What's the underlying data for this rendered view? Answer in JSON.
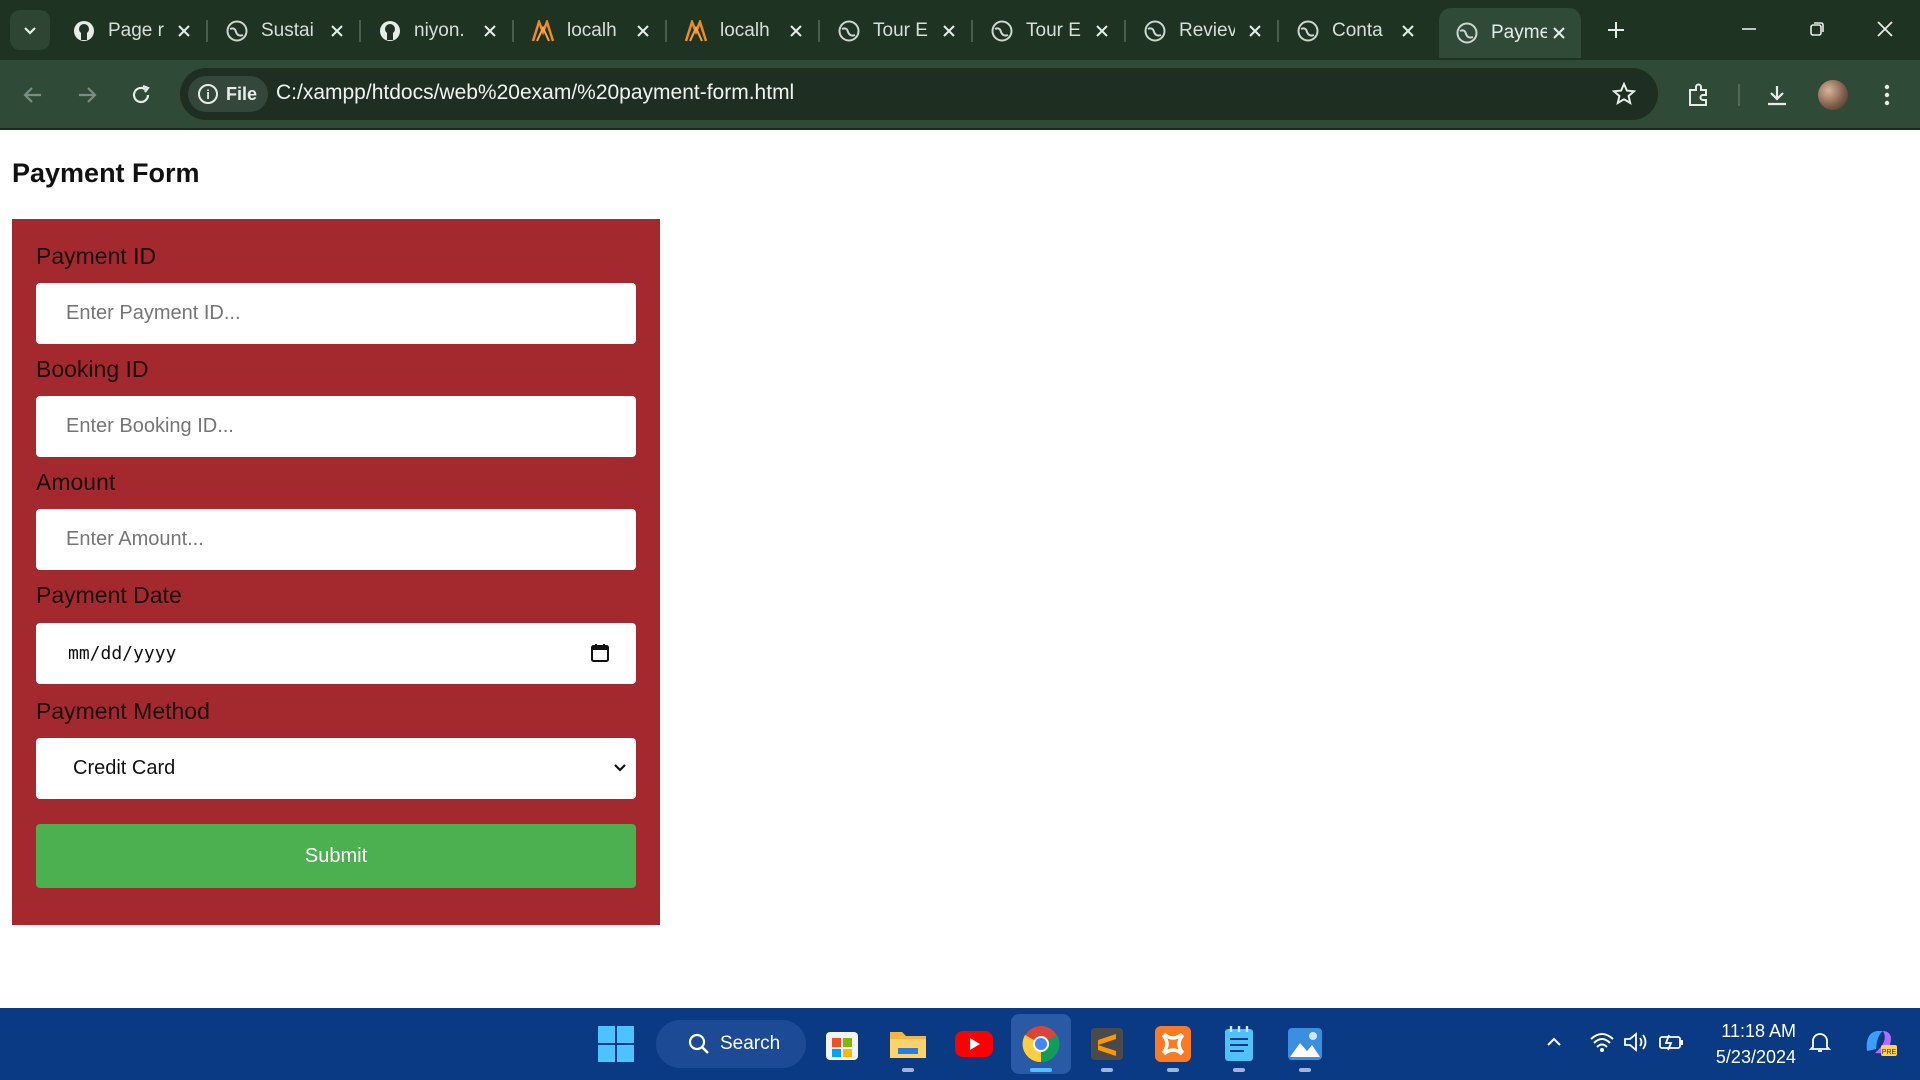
{
  "browser": {
    "tabs": [
      {
        "title": "Page r",
        "icon": "github-icon"
      },
      {
        "title": "Sustai",
        "icon": "globe-icon"
      },
      {
        "title": "niyon.",
        "icon": "github-icon"
      },
      {
        "title": "localh",
        "icon": "xampp-icon"
      },
      {
        "title": "localh",
        "icon": "xampp-icon"
      },
      {
        "title": "Tour E",
        "icon": "globe-icon"
      },
      {
        "title": "Tour E",
        "icon": "globe-icon"
      },
      {
        "title": "Reviev",
        "icon": "globe-icon"
      },
      {
        "title": "Conta",
        "icon": "globe-icon"
      },
      {
        "title": "Payme",
        "icon": "globe-icon",
        "active": true
      }
    ],
    "address_chip": "File",
    "url": "C:/xampp/htdocs/web%20exam/%20payment-form.html"
  },
  "page": {
    "title": "Payment Form",
    "form": {
      "payment_id": {
        "label": "Payment ID",
        "placeholder": "Enter Payment ID..."
      },
      "booking_id": {
        "label": "Booking ID",
        "placeholder": "Enter Booking ID..."
      },
      "amount": {
        "label": "Amount",
        "placeholder": "Enter Amount..."
      },
      "payment_date": {
        "label": "Payment Date",
        "placeholder": "mm/dd/yyyy"
      },
      "payment_method": {
        "label": "Payment Method",
        "value": "Credit Card"
      },
      "submit_label": "Submit"
    },
    "colors": {
      "form_bg": "#a4292e",
      "submit_bg": "#4caf50"
    }
  },
  "taskbar": {
    "search_label": "Search",
    "time": "11:18 AM",
    "date": "5/23/2024"
  }
}
